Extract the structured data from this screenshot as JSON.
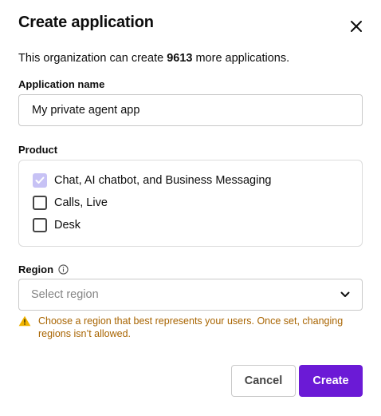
{
  "dialog": {
    "title": "Create application",
    "close_icon": "close-icon",
    "intro_prefix": "This organization can create ",
    "intro_count": "9613",
    "intro_suffix": " more applications."
  },
  "name_field": {
    "label": "Application name",
    "value": "My private agent app"
  },
  "product": {
    "label": "Product",
    "options": [
      {
        "label": "Chat, AI chatbot, and Business Messaging",
        "checked": true,
        "disabled": true
      },
      {
        "label": "Calls, Live",
        "checked": false,
        "disabled": false
      },
      {
        "label": "Desk",
        "checked": false,
        "disabled": false
      }
    ]
  },
  "region": {
    "label": "Region",
    "info_icon": "info-icon",
    "placeholder": "Select region",
    "chevron_icon": "chevron-down-icon",
    "warning_icon": "warning-icon",
    "warning_text": "Choose a region that best represents your users. Once set, changing regions isn’t allowed."
  },
  "actions": {
    "cancel_label": "Cancel",
    "create_label": "Create"
  },
  "colors": {
    "primary": "#6b1ad6",
    "warning": "#a86400",
    "checked_disabled": "#c7c2f5"
  }
}
